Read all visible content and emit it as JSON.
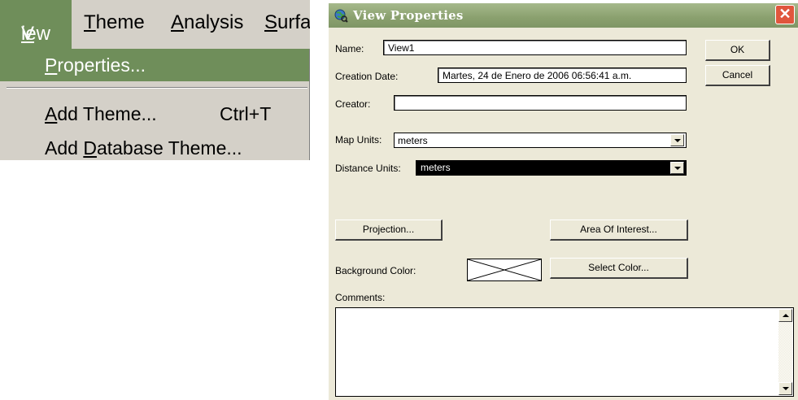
{
  "menubar": {
    "items": [
      {
        "label": "View",
        "mnemonic": "V",
        "rest": "iew"
      },
      {
        "label": "Theme",
        "mnemonic": "T",
        "rest": "heme"
      },
      {
        "label": "Analysis",
        "mnemonic": "A",
        "rest": "nalysis"
      },
      {
        "label": "Surfa",
        "mnemonic": "S",
        "rest": "urfa"
      }
    ]
  },
  "dropdown": {
    "items": [
      {
        "label": "Properties...",
        "mnemonic": "P",
        "rest": "roperties..."
      },
      {
        "label": "Add Theme...",
        "mnemonic": "A",
        "rest": "dd Theme...",
        "shortcut": "Ctrl+T"
      },
      {
        "label": "Add Database Theme...",
        "pre": "Add ",
        "mnemonic": "D",
        "rest": "atabase Theme..."
      }
    ]
  },
  "dialog": {
    "title": "View Properties",
    "name_label": "Name:",
    "name_value": "View1",
    "creation_date_label": "Creation Date:",
    "creation_date_value": "Martes, 24 de Enero de 2006 06:56:41 a.m.",
    "creator_label": "Creator:",
    "creator_value": "",
    "map_units_label": "Map Units:",
    "map_units_value": "meters",
    "distance_units_label": "Distance Units:",
    "distance_units_value": "meters",
    "ok_label": "OK",
    "cancel_label": "Cancel",
    "projection_label": "Projection...",
    "area_of_interest_label": "Area Of Interest...",
    "background_color_label": "Background Color:",
    "select_color_label": "Select Color...",
    "comments_label": "Comments:",
    "comments_value": ""
  },
  "colors": {
    "menu_highlight": "#6f8e5a",
    "titlebar": "#8aa06e",
    "dialog_bg": "#ece9d8",
    "close_button": "#e0563d"
  }
}
